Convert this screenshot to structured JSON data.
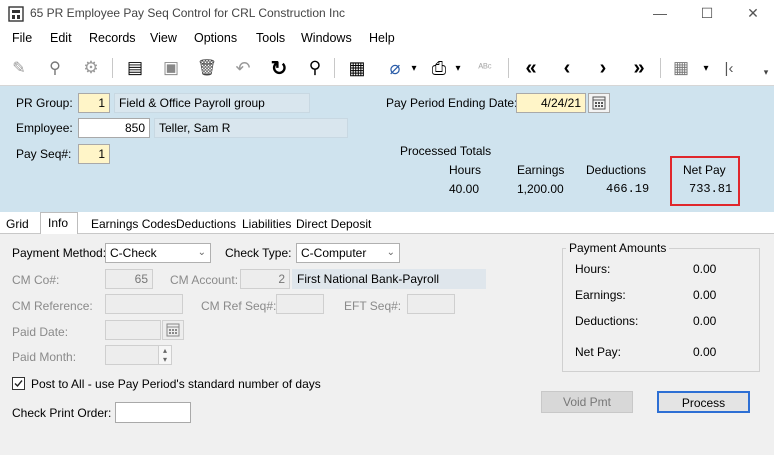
{
  "window": {
    "title": "65 PR Employee Pay Seq Control for CRL Construction Inc",
    "minimize": "—",
    "maximize": "☐",
    "close": "✕"
  },
  "menu": {
    "file": "File",
    "edit": "Edit",
    "records": "Records",
    "view": "View",
    "options": "Options",
    "tools": "Tools",
    "windows": "Windows",
    "help": "Help"
  },
  "toolbar": {
    "edit_icon": "✎",
    "find_icon": "⚲",
    "settings_icon": "⚙",
    "doc_icon": "▤",
    "save_icon": "▣",
    "delete_icon": "🗑",
    "undo_icon": "↶",
    "refresh_icon": "↻",
    "search_icon": "⚲",
    "grid_icon": "▦",
    "attach_icon": "⌀",
    "dd1": "▾",
    "print_icon": "⎙",
    "dd2": "▾",
    "spell_icon": "ᴬᴮᶜ",
    "first": "«",
    "prev": "‹",
    "next": "›",
    "last": "»",
    "layout_icon": "▦",
    "dd3": "▾",
    "collapse": "|‹",
    "overflow": "▾"
  },
  "header": {
    "pr_group_label": "PR Group:",
    "pr_group_value": "1",
    "pr_group_desc": "Field & Office Payroll group",
    "employee_label": "Employee:",
    "employee_value": "850",
    "employee_name": "Teller, Sam R",
    "pay_seq_label": "Pay Seq#:",
    "pay_seq_value": "1",
    "period_end_label": "Pay Period Ending Date:",
    "period_end_value": "4/24/21",
    "processed_totals_label": "Processed Totals",
    "hours_label": "Hours",
    "earnings_label": "Earnings",
    "deductions_label": "Deductions",
    "net_pay_label": "Net Pay",
    "hours_value": "40.00",
    "earnings_value": "1,200.00",
    "deductions_value": "466.19",
    "net_pay_value": "733.81"
  },
  "tabs": [
    "Grid",
    "Info",
    "Earnings Codes",
    "Deductions",
    "Liabilities",
    "Direct Deposit"
  ],
  "info": {
    "payment_method_label": "Payment Method:",
    "payment_method_value": "C-Check",
    "check_type_label": "Check Type:",
    "check_type_value": "C-Computer",
    "cm_co_label": "CM Co#:",
    "cm_co_value": "65",
    "cm_account_label": "CM Account:",
    "cm_account_value": "2",
    "cm_account_desc": "First National Bank-Payroll",
    "cm_reference_label": "CM Reference:",
    "cm_ref_seq_label": "CM Ref Seq#:",
    "eft_seq_label": "EFT Seq#:",
    "paid_date_label": "Paid Date:",
    "paid_month_label": "Paid Month:",
    "post_to_all_label": "Post to All - use Pay Period's standard number of days",
    "check_print_order_label": "Check Print Order:"
  },
  "payment_amounts": {
    "title": "Payment Amounts",
    "hours_label": "Hours:",
    "hours_value": "0.00",
    "earnings_label": "Earnings:",
    "earnings_value": "0.00",
    "deductions_label": "Deductions:",
    "deductions_value": "0.00",
    "net_pay_label": "Net Pay:",
    "net_pay_value": "0.00"
  },
  "buttons": {
    "void_pmt": "Void Pmt",
    "process": "Process"
  },
  "colors": {
    "header_bg": "#cfe3ee",
    "highlight_border": "#e0262b",
    "input_yellow": "#fff5c8"
  }
}
